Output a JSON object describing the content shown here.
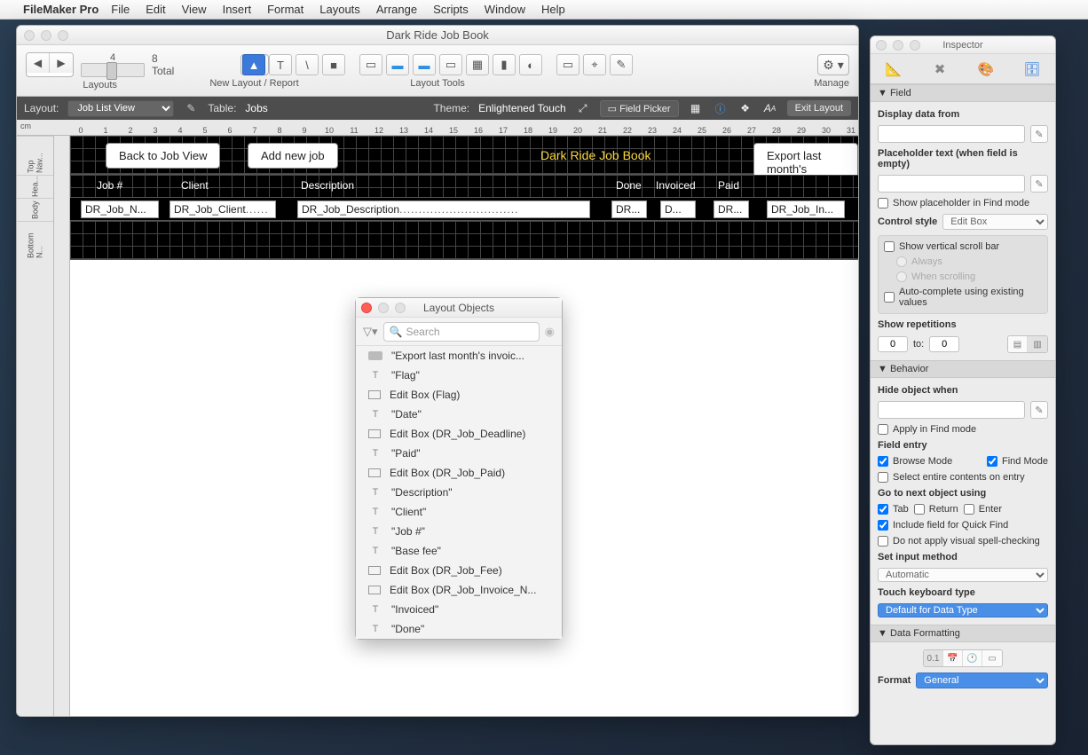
{
  "menubar": {
    "app": "FileMaker Pro",
    "items": [
      "File",
      "Edit",
      "View",
      "Insert",
      "Format",
      "Layouts",
      "Arrange",
      "Scripts",
      "Window",
      "Help"
    ]
  },
  "window": {
    "title": "Dark Ride Job Book",
    "records": {
      "current": "4",
      "total": "8",
      "total_label": "Total"
    },
    "toolbar": {
      "layouts": "Layouts",
      "newlayout": "New Layout / Report",
      "layout_tools": "Layout Tools",
      "manage": "Manage"
    },
    "formatbar": {
      "layout_label": "Layout:",
      "layout_value": "Job List View",
      "table_label": "Table:",
      "table_value": "Jobs",
      "theme_label": "Theme:",
      "theme_value": "Enlightened Touch",
      "field_picker": "Field Picker",
      "exit": "Exit Layout"
    },
    "ruler_unit": "cm",
    "ruler_ticks": [
      "0",
      "1",
      "2",
      "3",
      "4",
      "5",
      "6",
      "7",
      "8",
      "9",
      "10",
      "11",
      "12",
      "13",
      "14",
      "15",
      "16",
      "17",
      "18",
      "19",
      "20",
      "21",
      "22",
      "23",
      "24",
      "25",
      "26",
      "27",
      "28",
      "29",
      "30",
      "31"
    ],
    "side_segments": [
      "Top Nav...",
      "Hea...",
      "Body",
      "Bottom N..."
    ]
  },
  "layout_canvas": {
    "buttons": {
      "back": "Back to Job View",
      "add": "Add new job",
      "export": "Export last month's"
    },
    "title": "Dark Ride Job Book",
    "headers": [
      "Job #",
      "Client",
      "Description",
      "Done",
      "Invoiced",
      "Paid"
    ],
    "fields": [
      "DR_Job_N...",
      "DR_Job_Client",
      "DR_Job_Description",
      "DR...",
      "D...",
      "DR...",
      "DR_Job_In..."
    ]
  },
  "layout_objects": {
    "title": "Layout Objects",
    "search_placeholder": "Search",
    "items": [
      {
        "type": "btn",
        "label": "\"Export last month's invoic..."
      },
      {
        "type": "text",
        "label": "\"Flag\""
      },
      {
        "type": "box",
        "label": "Edit Box (Flag)"
      },
      {
        "type": "text",
        "label": "\"Date\""
      },
      {
        "type": "box",
        "label": "Edit Box (DR_Job_Deadline)"
      },
      {
        "type": "text",
        "label": "\"Paid\""
      },
      {
        "type": "box",
        "label": "Edit Box (DR_Job_Paid)"
      },
      {
        "type": "text",
        "label": "\"Description\""
      },
      {
        "type": "text",
        "label": "\"Client\""
      },
      {
        "type": "text",
        "label": "\"Job #\""
      },
      {
        "type": "text",
        "label": "\"Base fee\""
      },
      {
        "type": "box",
        "label": "Edit Box (DR_Job_Fee)"
      },
      {
        "type": "box",
        "label": "Edit Box (DR_Job_Invoice_N..."
      },
      {
        "type": "text",
        "label": "\"Invoiced\""
      },
      {
        "type": "text",
        "label": "\"Done\""
      }
    ]
  },
  "inspector": {
    "title": "Inspector",
    "sections": {
      "field": "Field",
      "behavior": "Behavior",
      "data_formatting": "Data Formatting"
    },
    "field": {
      "display_from": "Display data from",
      "placeholder_label": "Placeholder text (when field is empty)",
      "show_placeholder_find": "Show placeholder in Find mode",
      "control_style_label": "Control style",
      "control_style_value": "Edit Box",
      "show_vscroll": "Show vertical scroll bar",
      "always": "Always",
      "when_scrolling": "When scrolling",
      "autocomplete": "Auto-complete using existing values",
      "show_reps": "Show repetitions",
      "rep_from": "0",
      "rep_to_label": "to:",
      "rep_to": "0"
    },
    "behavior": {
      "hide_when": "Hide object when",
      "apply_find": "Apply in Find mode",
      "field_entry": "Field entry",
      "browse_mode": "Browse Mode",
      "find_mode": "Find Mode",
      "select_entire": "Select entire contents on entry",
      "goto_next": "Go to next object using",
      "tab": "Tab",
      "return": "Return",
      "enter": "Enter",
      "quick_find": "Include field for Quick Find",
      "spell": "Do not apply visual spell-checking",
      "input_method": "Set input method",
      "input_method_value": "Automatic",
      "touch_kb": "Touch keyboard type",
      "touch_kb_value": "Default for Data Type"
    },
    "format": {
      "label": "Format",
      "value": "General",
      "seg": "0.1"
    }
  }
}
